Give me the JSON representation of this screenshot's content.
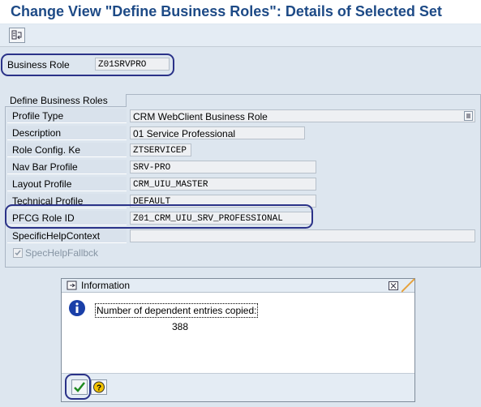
{
  "window": {
    "title": "Change View \"Define Business Roles\": Details of Selected Set"
  },
  "toolbar": {
    "buttons": [
      {
        "icon": "other-objects-icon"
      }
    ]
  },
  "key": {
    "label": "Business Role",
    "value": "Z01SRVPRO"
  },
  "group": {
    "title": "Define Business Roles",
    "fields": [
      {
        "label": "Profile Type",
        "value": "CRM WebClient Business Role"
      },
      {
        "label": "Description",
        "value": "01 Service Professional"
      },
      {
        "label": "Role Config. Ke",
        "value": "ZTSERVICEP"
      },
      {
        "label": "Nav Bar Profile",
        "value": "SRV-PRO"
      },
      {
        "label": "Layout Profile",
        "value": "CRM_UIU_MASTER"
      },
      {
        "label": "Technical Profile",
        "value": "DEFAULT"
      },
      {
        "label": "PFCG Role ID",
        "value": "Z01_CRM_UIU_SRV_PROFESSIONAL"
      },
      {
        "label": "SpecificHelpContext",
        "value": ""
      }
    ],
    "checkbox": {
      "label": "SpecHelpFallbck",
      "checked": true,
      "disabled": true
    }
  },
  "dialog": {
    "title": "Information",
    "message": "Number of dependent entries copied:",
    "count": "388",
    "icons": {
      "info": "info-icon",
      "ok": "checkmark-icon",
      "help": "help-icon",
      "close": "close-icon"
    }
  },
  "colors": {
    "title": "#1d4a86",
    "highlight": "#2a3288",
    "background": "#dde6ef"
  }
}
